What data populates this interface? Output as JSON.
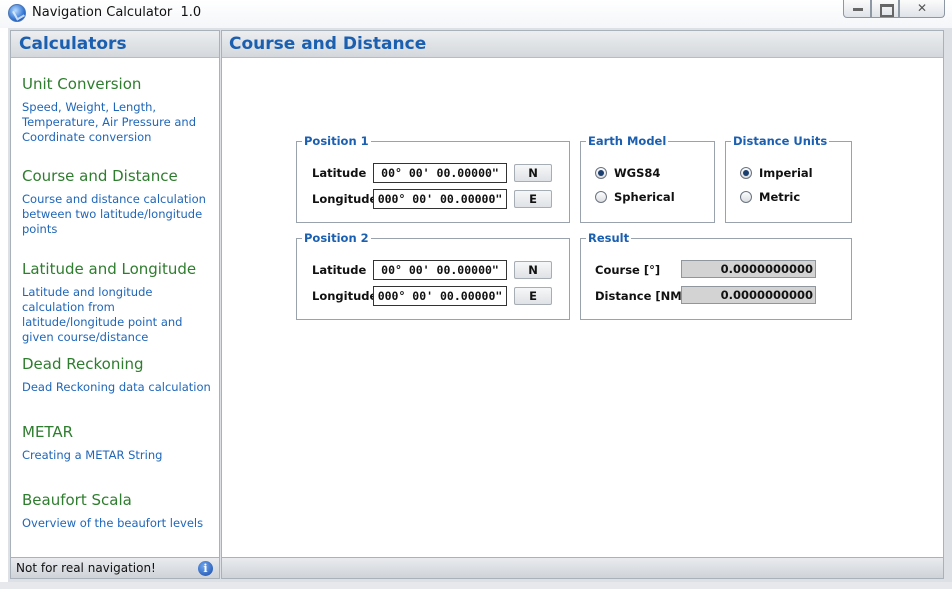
{
  "window": {
    "title": "Navigation Calculator",
    "version": "1.0"
  },
  "sidebar": {
    "header": "Calculators",
    "items": [
      {
        "title": "Unit Conversion",
        "desc": "Speed, Weight, Length, Temperature, Air Pressure and Coordinate conversion"
      },
      {
        "title": "Course and Distance",
        "desc": "Course and distance calculation between two latitude/longitude points"
      },
      {
        "title": "Latitude and Longitude",
        "desc": "Latitude and longitude calculation from latitude/longitude point and given course/distance"
      },
      {
        "title": "Dead Reckoning",
        "desc": "Dead Reckoning data calculation"
      },
      {
        "title": "METAR",
        "desc": "Creating a METAR String"
      },
      {
        "title": "Beaufort Scala",
        "desc": "Overview of the beaufort levels"
      }
    ],
    "footer": "Not for real navigation!",
    "info_icon": "i"
  },
  "main": {
    "header": "Course and Distance",
    "position1": {
      "legend": "Position 1",
      "latitude_label": "Latitude",
      "latitude_value": "00°  00'  00.00000\"",
      "latitude_hemisphere": "N",
      "longitude_label": "Longitude",
      "longitude_value": "000°  00'  00.00000\"",
      "longitude_hemisphere": "E"
    },
    "position2": {
      "legend": "Position 2",
      "latitude_label": "Latitude",
      "latitude_value": "00°  00'  00.00000\"",
      "latitude_hemisphere": "N",
      "longitude_label": "Longitude",
      "longitude_value": "000°  00'  00.00000\"",
      "longitude_hemisphere": "E"
    },
    "earth_model": {
      "legend": "Earth Model",
      "options": [
        "WGS84",
        "Spherical"
      ],
      "selected": "WGS84"
    },
    "distance_units": {
      "legend": "Distance Units",
      "options": [
        "Imperial",
        "Metric"
      ],
      "selected": "Imperial"
    },
    "result": {
      "legend": "Result",
      "course_label": "Course [°]",
      "course_value": "0.0000000000",
      "distance_label": "Distance [NM]",
      "distance_value": "0.0000000000"
    }
  }
}
